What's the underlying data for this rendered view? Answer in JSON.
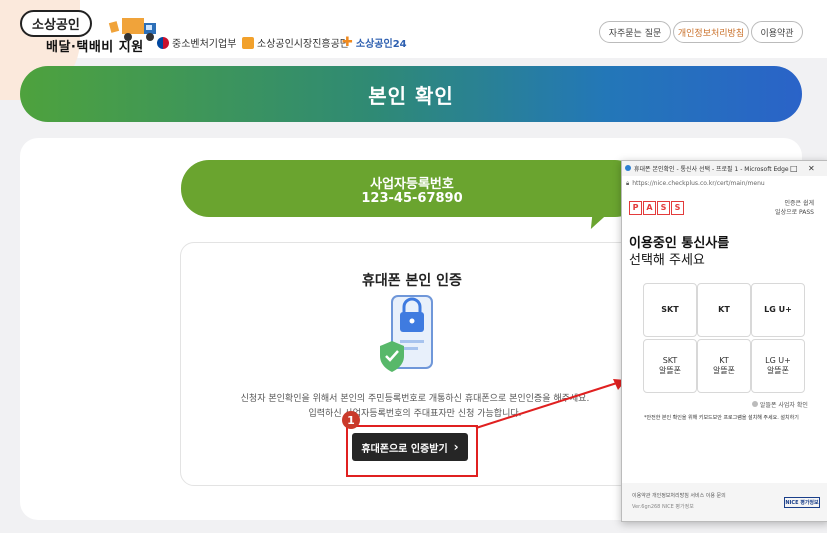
{
  "header": {
    "logo_top": "소상공인",
    "logo_bottom": "배달·택배비 지원",
    "orgs": [
      "중소벤처기업부",
      "소상공인시장진흥공단",
      "소상공인24"
    ],
    "buttons": [
      "자주묻는 질문",
      "개인정보처리방침",
      "이용약관"
    ]
  },
  "banner": {
    "title": "본인 확인"
  },
  "business": {
    "label": "사업자등록번호",
    "number": "123-45-67890"
  },
  "auth": {
    "title": "휴대폰 본인 인증",
    "desc_line1": "신청자 본인확인을 위해서 본인의 주민등록번호로 개통하신 휴대폰으로 본인인증을 해주세요.",
    "desc_line2": "입력하신 사업자등록번호의 주대표자만 신청 가능합니다.",
    "button_label": "휴대폰으로 인증받기",
    "step_badge": "1"
  },
  "popup": {
    "window_title": "휴대폰 본인확인 - 통신사 선택 - 프로필 1 - Microsoft Edge",
    "url": "https://nice.checkplus.co.kr/cert/main/menu",
    "pass_letters": [
      "P",
      "A",
      "S",
      "S"
    ],
    "pass_note_line1": "인증은 쉽게",
    "pass_note_line2": "일상으로 PASS",
    "heading_line1": "이용중인 통신사를",
    "heading_line2": "선택해 주세요",
    "carriers": [
      "SKT",
      "KT",
      "LG U+"
    ],
    "mvno_top": [
      "SKT",
      "KT",
      "LG U+"
    ],
    "mvno_label": "알뜰폰",
    "mvno_help": "알뜰폰 사업자 확인",
    "warning": "*안전한 본인 확인을 위해 키보드보안 프로그램을 설치해 주세요. 설치하기",
    "footer_line1": "이용약관   개인정보처리방침   서비스 이용 문의",
    "footer_line2": "Ver.6gn268  NICE 평가정보",
    "nice_badge": "NICE 평가정보",
    "ctrl_min": "–",
    "ctrl_max": "□",
    "ctrl_close": "✕"
  },
  "colors": {
    "banner_start": "#4ea23d",
    "banner_end": "#2a63c8",
    "bubble": "#6aa42f",
    "highlight": "#e02020",
    "pass_red": "#e33b3b"
  }
}
